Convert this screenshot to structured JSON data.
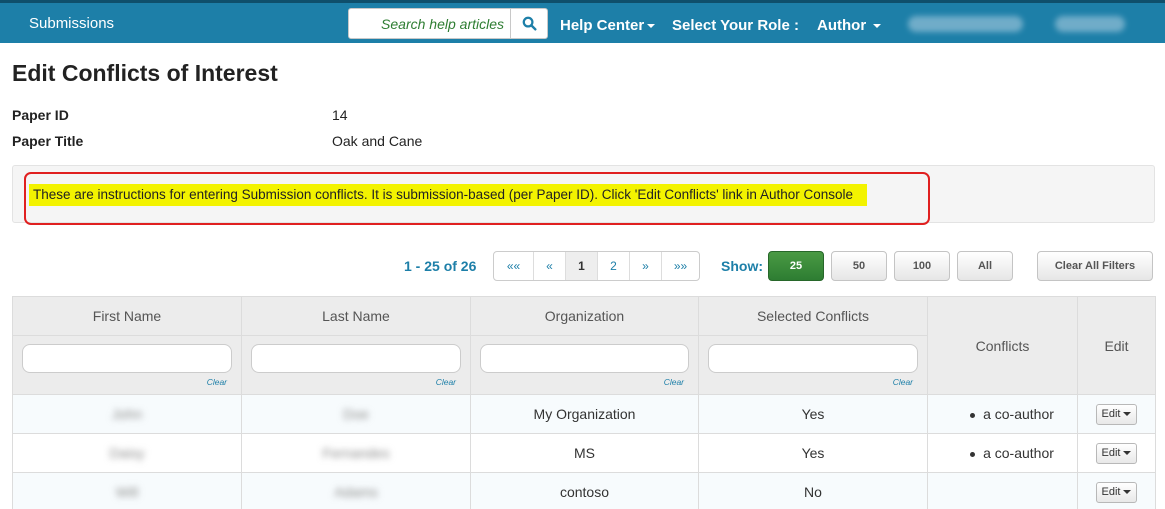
{
  "topbar": {
    "brand": "Submissions",
    "search_placeholder": "Search help articles",
    "search_icon": "search-icon",
    "help_center": "Help Center",
    "role_label": "Select Your Role :",
    "role_value": "Author"
  },
  "page": {
    "title": "Edit Conflicts of Interest",
    "paper_id_label": "Paper ID",
    "paper_id_value": "14",
    "paper_title_label": "Paper Title",
    "paper_title_value": "Oak and Cane",
    "instructions": "These are instructions for entering Submission conflicts. It is submission-based (per Paper ID). Click 'Edit Conflicts' link in Author Console"
  },
  "pager": {
    "range": "1 - 25 of 26",
    "first": "««",
    "prev": "«",
    "pages": [
      "1",
      "2"
    ],
    "next": "»",
    "last": "»»",
    "show_label": "Show:",
    "sizes": [
      "25",
      "50",
      "100",
      "All"
    ],
    "active_size": "25",
    "clear_filters": "Clear All Filters"
  },
  "table": {
    "columns": {
      "first_name": "First Name",
      "last_name": "Last Name",
      "organization": "Organization",
      "selected_conflicts": "Selected Conflicts",
      "conflicts": "Conflicts",
      "edit": "Edit"
    },
    "filter_clear": "Clear",
    "edit_button": "Edit",
    "rows": [
      {
        "first": "John",
        "last": "Doe",
        "org": "My Organization",
        "selected": "Yes",
        "conflict": "a co-author"
      },
      {
        "first": "Daisy",
        "last": "Fernandes",
        "org": "MS",
        "selected": "Yes",
        "conflict": "a co-author"
      },
      {
        "first": "Will",
        "last": "Adams",
        "org": "contoso",
        "selected": "No",
        "conflict": ""
      }
    ]
  },
  "colors": {
    "nav_bg": "#1d7fa8",
    "accent": "#1d7fa8",
    "active_button": "#2e7d32",
    "highlight": "#f3f300",
    "outline": "#e02020"
  }
}
